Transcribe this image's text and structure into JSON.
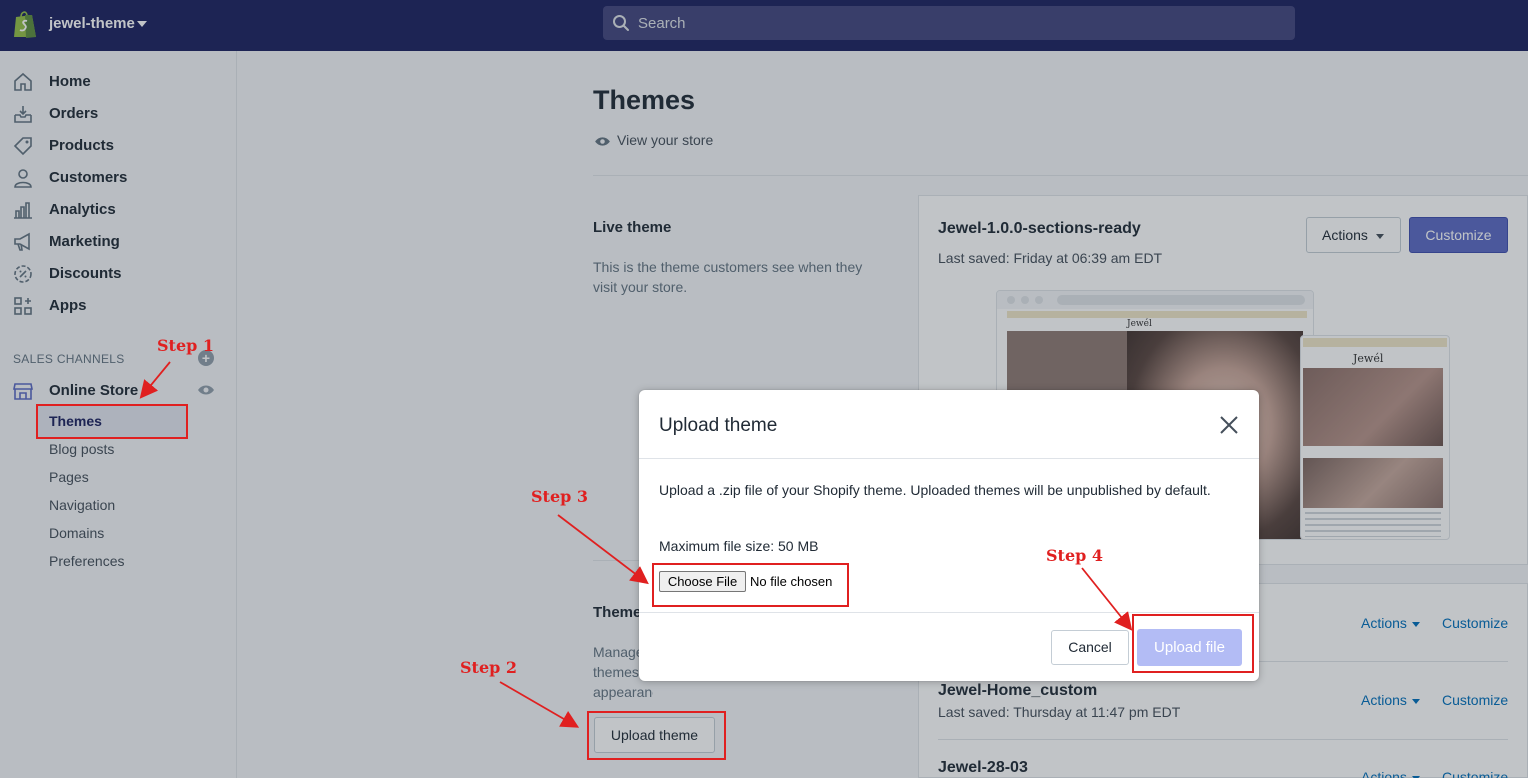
{
  "topbar": {
    "store_name": "jewel-theme",
    "search_placeholder": "Search"
  },
  "sidebar": {
    "items": [
      {
        "label": "Home",
        "icon": "home-icon"
      },
      {
        "label": "Orders",
        "icon": "orders-icon"
      },
      {
        "label": "Products",
        "icon": "tag-icon"
      },
      {
        "label": "Customers",
        "icon": "person-icon"
      },
      {
        "label": "Analytics",
        "icon": "bar-chart-icon"
      },
      {
        "label": "Marketing",
        "icon": "megaphone-icon"
      },
      {
        "label": "Discounts",
        "icon": "discount-icon"
      },
      {
        "label": "Apps",
        "icon": "apps-icon"
      }
    ],
    "sales_channels_heading": "SALES CHANNELS",
    "online_store_label": "Online Store",
    "sub_items": [
      "Themes",
      "Blog posts",
      "Pages",
      "Navigation",
      "Domains",
      "Preferences"
    ]
  },
  "main": {
    "title": "Themes",
    "view_store": "View your store",
    "live_theme": {
      "heading": "Live theme",
      "description": "This is the theme customers see when they visit your store.",
      "name": "Jewel-1.0.0-sections-ready",
      "last_saved": "Last saved: Friday at 06:39 am EDT",
      "actions_label": "Actions",
      "customize_label": "Customize",
      "preview_logo": "Jewél",
      "preview_logo_mobile": "Jewél"
    },
    "library": {
      "heading": "Theme",
      "description": "Manage themes appearance.",
      "upload_label": "Upload theme",
      "rows": [
        {
          "name": "",
          "last_saved": "",
          "actions": "Actions",
          "customize": "Customize"
        },
        {
          "name": "Jewel-Home_custom",
          "last_saved": "Last saved: Thursday at 11:47 pm EDT",
          "actions": "Actions",
          "customize": "Customize"
        },
        {
          "name": "Jewel-28-03",
          "last_saved": "",
          "actions": "Actions",
          "customize": "Customize"
        }
      ]
    }
  },
  "modal": {
    "title": "Upload theme",
    "description": "Upload a .zip file of your Shopify theme. Uploaded themes will be unpublished by default.",
    "max_size": "Maximum file size: 50 MB",
    "choose_file": "Choose File",
    "no_file": "No file chosen",
    "cancel": "Cancel",
    "upload_file": "Upload file"
  },
  "annotations": {
    "step1": "Step 1",
    "step2": "Step 2",
    "step3": "Step 3",
    "step4": "Step 4",
    "color": "#e02020"
  },
  "colors": {
    "topbar": "#1c2260",
    "primary": "#5c6ac4",
    "link": "#006fbb",
    "disabled_primary": "#b3bcf5"
  }
}
